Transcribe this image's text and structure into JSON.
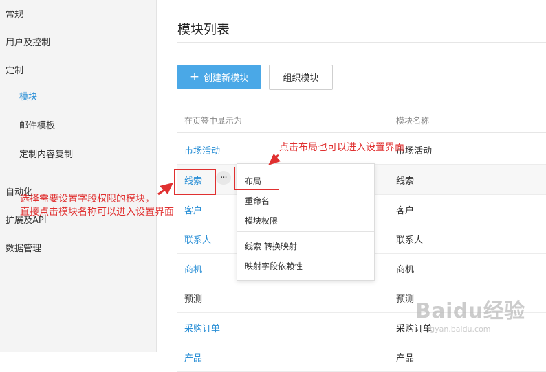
{
  "sidebar": {
    "general": "常规",
    "users_control": "用户及控制",
    "customize": "定制",
    "modules": "模块",
    "email_templates": "邮件模板",
    "copy_customization": "定制内容复制",
    "automation": "自动化",
    "extensions_api": "扩展及API",
    "data_management": "数据管理"
  },
  "page": {
    "title": "模块列表",
    "create_button": "创建新模块",
    "organize_button": "组织模块"
  },
  "table": {
    "headers": [
      "在页签中显示为",
      "模块名称"
    ],
    "rows": [
      {
        "display": "市场活动",
        "name": "市场活动"
      },
      {
        "display": "线索",
        "name": "线索"
      },
      {
        "display": "客户",
        "name": "客户"
      },
      {
        "display": "联系人",
        "name": "联系人"
      },
      {
        "display": "商机",
        "name": "商机"
      },
      {
        "display": "预测",
        "name": "预测"
      },
      {
        "display": "采购订单",
        "name": "采购订单"
      },
      {
        "display": "产品",
        "name": "产品"
      }
    ]
  },
  "more_button": "···",
  "dropdown": {
    "layout": "布局",
    "rename": "重命名",
    "permissions": "模块权限",
    "lead_conversion": "线索 转换映射",
    "field_dependency": "映射字段依赖性"
  },
  "annotations": {
    "top": "点击布局也可以进入设置界面",
    "left_line1": "选择需要设置字段权限的模块，",
    "left_line2": "直接点击模块名称可以进入设置界面"
  },
  "watermark": {
    "logo": "Baidu经验",
    "url": "jingyan.baidu.com"
  },
  "colors": {
    "accent": "#2a8fd6",
    "primary_button": "#4aa8e7",
    "annotation": "#e03030"
  }
}
